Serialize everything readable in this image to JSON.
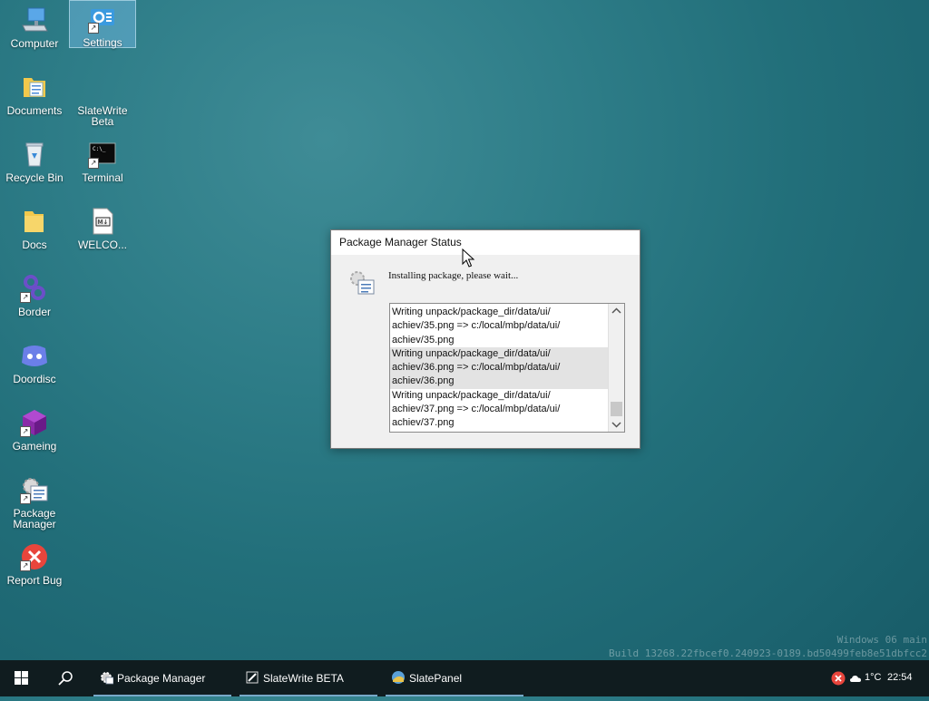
{
  "desktop_icons": [
    {
      "id": "computer",
      "label": "Computer"
    },
    {
      "id": "settings",
      "label": "Settings",
      "selected": true
    },
    {
      "id": "documents",
      "label": "Documents"
    },
    {
      "id": "slatewrite",
      "label": "SlateWrite Beta"
    },
    {
      "id": "recycle",
      "label": "Recycle Bin"
    },
    {
      "id": "terminal",
      "label": "Terminal"
    },
    {
      "id": "docs",
      "label": "Docs"
    },
    {
      "id": "welcome",
      "label": "WELCO..."
    },
    {
      "id": "border",
      "label": "Border"
    },
    {
      "id": "doordisc",
      "label": "Doordisc"
    },
    {
      "id": "gameing",
      "label": "Gameing"
    },
    {
      "id": "packagemanager",
      "label": "Package Manager"
    },
    {
      "id": "reportbug",
      "label": "Report Bug"
    }
  ],
  "watermark": {
    "line1": "Windows 06 main",
    "line2": "Build 13268.22fbcef0.240923-0189.bd50499feb8e51dbfcc2"
  },
  "dialog": {
    "title": "Package Manager Status",
    "message": "Installing package, please wait...",
    "log_entries": [
      {
        "line1": "Writing unpack/package_dir/data/ui/",
        "line2": "achiev/35.png => c:/local/mbp/data/ui/",
        "line3": "achiev/35.png"
      },
      {
        "line1": "Writing unpack/package_dir/data/ui/",
        "line2": "achiev/36.png => c:/local/mbp/data/ui/",
        "line3": "achiev/36.png"
      },
      {
        "line1": "Writing unpack/package_dir/data/ui/",
        "line2": "achiev/37.png => c:/local/mbp/data/ui/",
        "line3": "achiev/37.png"
      }
    ]
  },
  "taskbar": {
    "tasks": [
      {
        "label": "Package Manager",
        "icon": "gear-icon"
      },
      {
        "label": "SlateWrite BETA",
        "icon": "pen-icon"
      },
      {
        "label": "SlatePanel",
        "icon": "slatepanel-icon"
      }
    ],
    "tray": {
      "temperature": "1°C",
      "clock": "22:54"
    }
  },
  "colors": {
    "taskbar": "#101c1f",
    "accent": "#78a9c9"
  }
}
